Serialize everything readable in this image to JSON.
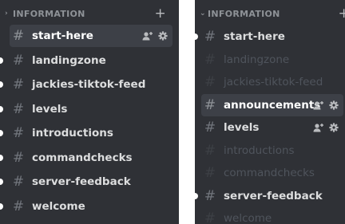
{
  "left_panel": {
    "category": "INFORMATION",
    "channels": [
      {
        "name": "start-here",
        "selected": true,
        "muted": false,
        "unread": false,
        "icons": true
      },
      {
        "name": "landingzone",
        "selected": false,
        "muted": false,
        "unread": true,
        "icons": false
      },
      {
        "name": "jackies-tiktok-feed",
        "selected": false,
        "muted": false,
        "unread": true,
        "icons": false
      },
      {
        "name": "levels",
        "selected": false,
        "muted": false,
        "unread": true,
        "icons": false
      },
      {
        "name": "introductions",
        "selected": false,
        "muted": false,
        "unread": true,
        "icons": false
      },
      {
        "name": "commandchecks",
        "selected": false,
        "muted": false,
        "unread": true,
        "icons": false
      },
      {
        "name": "server-feedback",
        "selected": false,
        "muted": false,
        "unread": true,
        "icons": false
      },
      {
        "name": "welcome",
        "selected": false,
        "muted": false,
        "unread": true,
        "icons": false
      }
    ]
  },
  "right_panel": {
    "category": "INFORMATION",
    "channels": [
      {
        "name": "start-here",
        "selected": false,
        "muted": false,
        "unread": true,
        "icons": false
      },
      {
        "name": "landingzone",
        "selected": false,
        "muted": true,
        "unread": false,
        "icons": false
      },
      {
        "name": "jackies-tiktok-feed",
        "selected": false,
        "muted": true,
        "unread": false,
        "icons": false
      },
      {
        "name": "announcements",
        "selected": true,
        "muted": false,
        "unread": false,
        "icons": true
      },
      {
        "name": "levels",
        "selected": false,
        "muted": false,
        "unread": false,
        "icons": true
      },
      {
        "name": "introductions",
        "selected": false,
        "muted": true,
        "unread": false,
        "icons": false
      },
      {
        "name": "commandchecks",
        "selected": false,
        "muted": true,
        "unread": false,
        "icons": false
      },
      {
        "name": "server-feedback",
        "selected": false,
        "muted": false,
        "unread": true,
        "icons": false
      },
      {
        "name": "welcome",
        "selected": false,
        "muted": true,
        "unread": false,
        "icons": false
      }
    ]
  },
  "icons": {
    "channel": "hash-icon",
    "invite": "add-member-icon",
    "settings": "gear-icon",
    "category_toggle": "chevron-icon",
    "create": "plus-icon"
  },
  "colors": {
    "panel_bg": "#2f3136",
    "selected_bg": "#3d4047",
    "text": "#dcddde",
    "muted_text": "#4f545c",
    "category": "#8e9297",
    "unread_dot": "#ffffff"
  }
}
